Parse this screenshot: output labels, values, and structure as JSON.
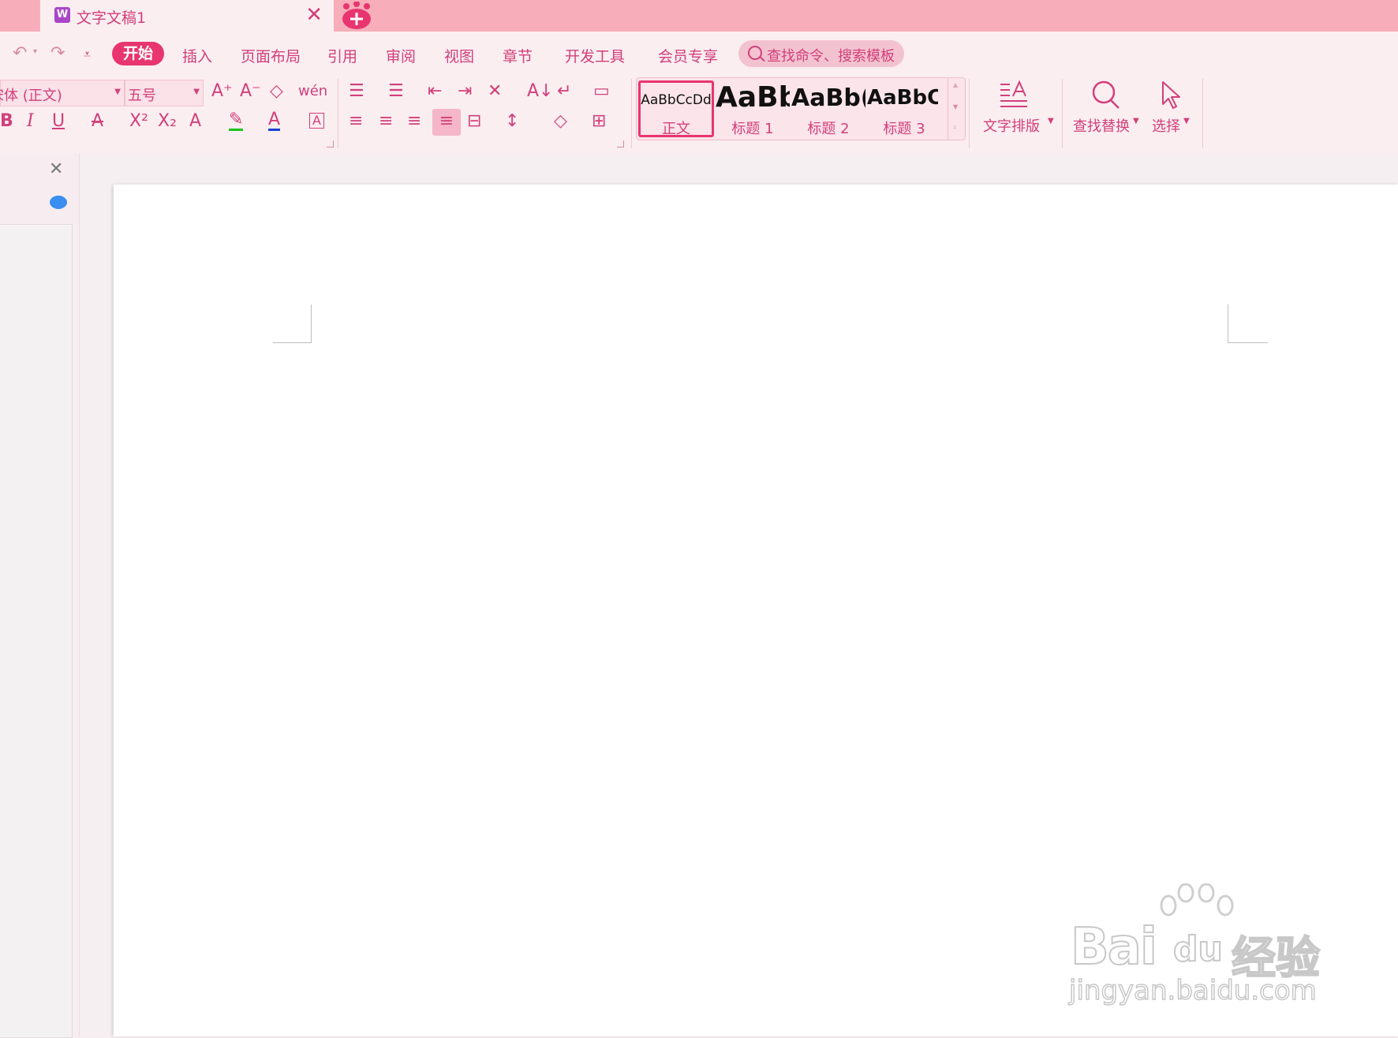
{
  "tab": {
    "title": "文字文稿1",
    "close": "✕",
    "icon": "W"
  },
  "menu": {
    "start": "开始",
    "items": [
      "插入",
      "页面布局",
      "引用",
      "审阅",
      "视图",
      "章节",
      "开发工具",
      "会员专享"
    ],
    "search_placeholder": "查找命令、搜索模板"
  },
  "font": {
    "family": "宋体 (正文)",
    "size": "五号"
  },
  "format_icons": {
    "row1": [
      "A⁺",
      "A⁻",
      "◇",
      "wén"
    ],
    "row2": [
      "B",
      "I",
      "U",
      "A",
      "X²",
      "X₂",
      "A",
      "✎",
      "A",
      "A"
    ]
  },
  "para_icons": {
    "row1": [
      "☰",
      "☰",
      "⇤",
      "⇥",
      "✕",
      "A↓",
      "↵",
      "▭"
    ],
    "row2": [
      "≡",
      "≡",
      "≡",
      "≡",
      "⊟",
      "↕",
      "◇",
      "⊞"
    ]
  },
  "styles": [
    {
      "sample": "AaBbCcDd",
      "label": "正文"
    },
    {
      "sample": "AaBb",
      "label": "标题 1"
    },
    {
      "sample": "AaBb(",
      "label": "标题 2"
    },
    {
      "sample": "AaBbC",
      "label": "标题 3"
    }
  ],
  "buttons": {
    "text_layout": "文字排版",
    "find_replace": "查找替换",
    "select": "选择"
  },
  "watermark": {
    "brand": "Bai",
    "du": "du",
    "jingyan": "经验",
    "url": "jingyan.baidu.com"
  },
  "colors": {
    "accent": "#e8356f",
    "titlebar": "#f7adba",
    "ribbon": "#faeef1",
    "text": "#d23f7a"
  }
}
